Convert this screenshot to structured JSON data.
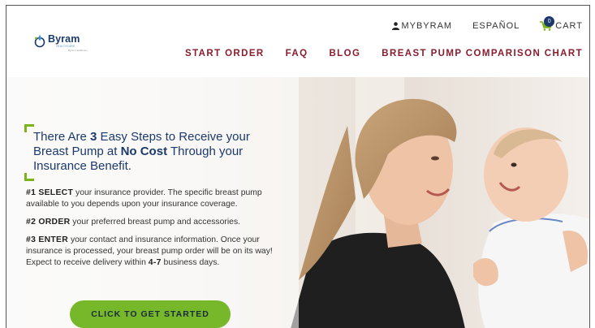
{
  "logo": {
    "name": "Byram",
    "sub": "HEALTHCARE",
    "sub2": "Byram Healthcare"
  },
  "util_nav": {
    "account": "MYBYRAM",
    "language": "ESPAÑOL",
    "cart": "CART",
    "cart_count": "0"
  },
  "main_nav": [
    {
      "label": "START ORDER"
    },
    {
      "label": "FAQ"
    },
    {
      "label": "BLOG"
    },
    {
      "label": "BREAST PUMP COMPARISON CHART"
    }
  ],
  "hero": {
    "headline_1": "There Are ",
    "headline_num": "3",
    "headline_2": " Easy Steps to Receive your Breast Pump at ",
    "headline_bold": "No Cost",
    "headline_3": " Through your Insurance Benefit.",
    "steps": [
      {
        "key": "#1 SELECT",
        "text": " your insurance provider. The specific breast pump available to you depends upon your insurance coverage."
      },
      {
        "key": "#2 ORDER",
        "text": " your preferred breast pump and accessories."
      },
      {
        "key": "#3 ENTER",
        "text": " your contact and insurance information. Once your insurance is processed, your breast pump order will be on its way! Expect to receive delivery within ",
        "bold_days": "4-7",
        "text_end": " business days."
      }
    ],
    "cta": "CLICK TO GET STARTED"
  },
  "colors": {
    "navy": "#1b3a6b",
    "maroon": "#8a1c2e",
    "green": "#76b82a"
  }
}
